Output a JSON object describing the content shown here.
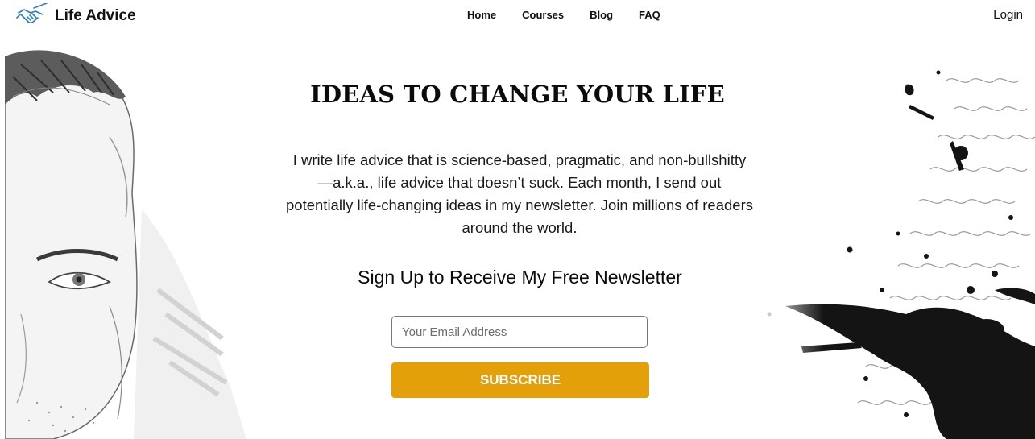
{
  "nav": {
    "logo_icon": "handshake-icon",
    "brand": "Life Advice",
    "links": [
      "Home",
      "Courses",
      "Blog",
      "FAQ"
    ],
    "login": "Login"
  },
  "hero": {
    "title": "IDEAS TO CHANGE YOUR LIFE",
    "intro": "I write life advice that is science-based, pragmatic, and non-bullshitty—a.k.a., life advice that doesn’t suck. Each month, I send out potentially life-changing ideas in my newsletter. Join millions of readers around the world.",
    "signup_heading": "Sign Up to Receive My Free Newsletter",
    "email_placeholder": "Your Email Address",
    "subscribe_label": "SUBSCRIBE"
  },
  "colors": {
    "accent": "#e3a008",
    "text": "#111111"
  }
}
